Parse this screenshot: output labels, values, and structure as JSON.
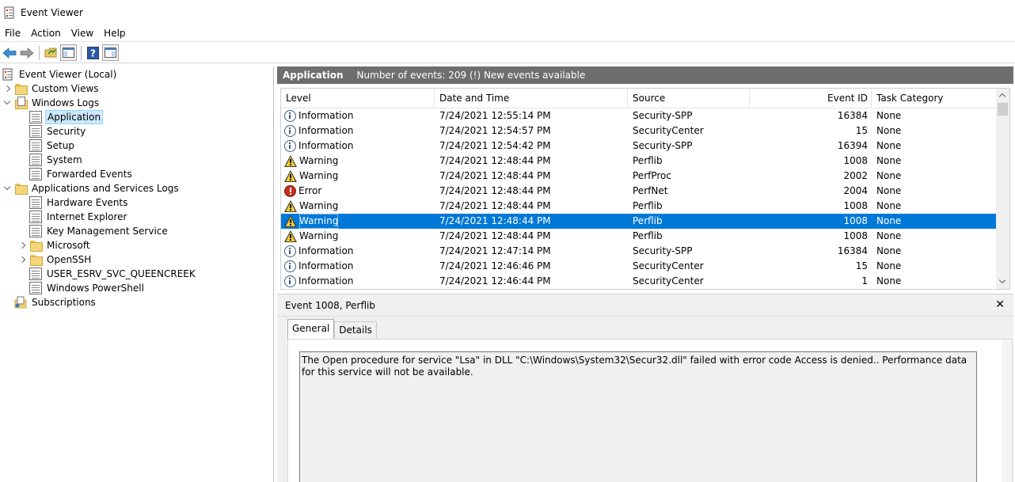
{
  "window": {
    "title": "Event Viewer"
  },
  "menu": [
    "File",
    "Action",
    "View",
    "Help"
  ],
  "toolbar": {
    "buttons": [
      "back-arrow-icon",
      "forward-arrow-icon",
      "open-folder-icon",
      "console-tree-icon",
      "help-icon",
      "action-pane-icon"
    ]
  },
  "tree": {
    "root": "Event Viewer (Local)",
    "custom_views": "Custom Views",
    "windows_logs": "Windows Logs",
    "windows_logs_items": [
      "Application",
      "Security",
      "Setup",
      "System",
      "Forwarded Events"
    ],
    "app_services": "Applications and Services Logs",
    "app_services_items": [
      "Hardware Events",
      "Internet Explorer",
      "Key Management Service",
      "Microsoft",
      "OpenSSH",
      "USER_ESRV_SVC_QUEENCREEK",
      "Windows PowerShell"
    ],
    "subscriptions": "Subscriptions"
  },
  "pane": {
    "title": "Application",
    "info": "Number of events: 209 (!) New events available"
  },
  "events": {
    "columns": [
      "Level",
      "Date and Time",
      "Source",
      "Event ID",
      "Task Category"
    ],
    "rows": [
      {
        "level": "Information",
        "date": "7/24/2021 12:55:14 PM",
        "source": "Security-SPP",
        "id": "16384",
        "task": "None"
      },
      {
        "level": "Information",
        "date": "7/24/2021 12:54:57 PM",
        "source": "SecurityCenter",
        "id": "15",
        "task": "None"
      },
      {
        "level": "Information",
        "date": "7/24/2021 12:54:42 PM",
        "source": "Security-SPP",
        "id": "16394",
        "task": "None"
      },
      {
        "level": "Warning",
        "date": "7/24/2021 12:48:44 PM",
        "source": "Perflib",
        "id": "1008",
        "task": "None"
      },
      {
        "level": "Warning",
        "date": "7/24/2021 12:48:44 PM",
        "source": "PerfProc",
        "id": "2002",
        "task": "None"
      },
      {
        "level": "Error",
        "date": "7/24/2021 12:48:44 PM",
        "source": "PerfNet",
        "id": "2004",
        "task": "None"
      },
      {
        "level": "Warning",
        "date": "7/24/2021 12:48:44 PM",
        "source": "Perflib",
        "id": "1008",
        "task": "None"
      },
      {
        "level": "Warning",
        "date": "7/24/2021 12:48:44 PM",
        "source": "Perflib",
        "id": "1008",
        "task": "None"
      },
      {
        "level": "Warning",
        "date": "7/24/2021 12:48:44 PM",
        "source": "Perflib",
        "id": "1008",
        "task": "None"
      },
      {
        "level": "Information",
        "date": "7/24/2021 12:47:14 PM",
        "source": "Security-SPP",
        "id": "16384",
        "task": "None"
      },
      {
        "level": "Information",
        "date": "7/24/2021 12:46:46 PM",
        "source": "SecurityCenter",
        "id": "15",
        "task": "None"
      },
      {
        "level": "Information",
        "date": "7/24/2021 12:46:44 PM",
        "source": "SecurityCenter",
        "id": "1",
        "task": "None"
      }
    ],
    "selected_index": 7
  },
  "details": {
    "title": "Event 1008, Perflib",
    "tabs": [
      "General",
      "Details"
    ],
    "active_tab": "General",
    "message": "The Open procedure for service \"Lsa\" in DLL \"C:\\Windows\\System32\\Secur32.dll\" failed with error code Access is denied.. Performance data for this service will not be available."
  },
  "colors": {
    "selection": "#0078d7",
    "pane_header": "#6e6e6e",
    "tree_selection": "#cce8ff"
  }
}
